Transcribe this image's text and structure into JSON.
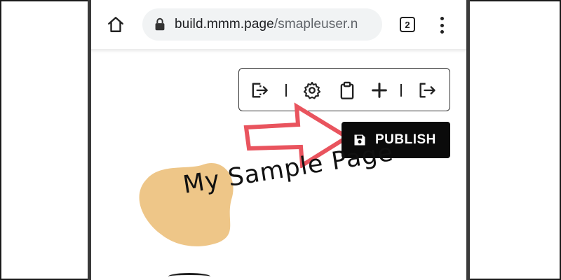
{
  "browser": {
    "url_host": "build.mmm.page",
    "url_path": "/smapleuser.n",
    "tab_count": "2"
  },
  "toolbar": {
    "icons": [
      "export-icon",
      "gear-icon",
      "clipboard-icon",
      "plus-icon",
      "logout-icon"
    ]
  },
  "publish": {
    "label": "PUBLISH",
    "icon": "save-icon"
  },
  "page": {
    "title": "My Sample Page"
  },
  "colors": {
    "arrow": "#e9545e",
    "blob": "#eec688",
    "publish_bg": "#0b0b0b",
    "url_bar": "#f1f3f4"
  }
}
